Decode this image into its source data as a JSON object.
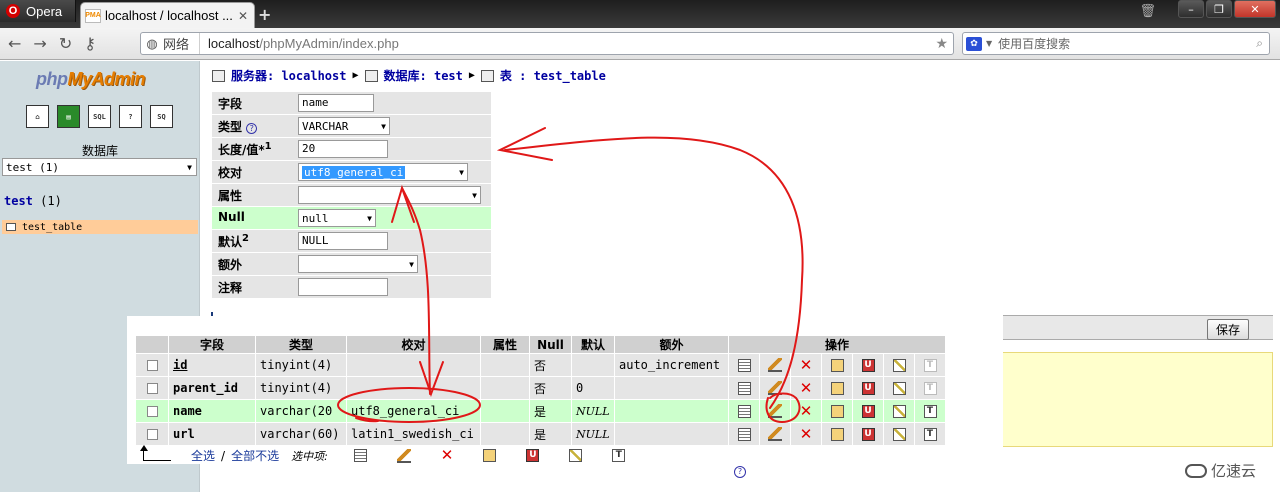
{
  "browser": {
    "opera_label": "Opera",
    "tab_title": "localhost / localhost ...",
    "tab_favicon": "PMA",
    "tab_close": "✕",
    "new_tab": "+",
    "url_net_label": "网络",
    "url_host": "localhost",
    "url_path": "/phpMyAdmin/index.php",
    "search_placeholder": "使用百度搜索"
  },
  "left": {
    "logo_php": "php",
    "logo_myadmin": "MyAdmin",
    "icons": [
      "home-icon",
      "query-window-icon",
      "sql-icon",
      "help-icon",
      "sql-doc-icon"
    ],
    "db_label": "数据库",
    "db_select_value": "test (1)",
    "db_title": "test",
    "db_count": "(1)",
    "table_item": "test_table"
  },
  "breadcrumb": {
    "server": "服务器: localhost",
    "database": "数据库: test",
    "table": "表 : test_table"
  },
  "form": {
    "field_label": "字段",
    "field_value": "name",
    "type_label": "类型",
    "type_value": "VARCHAR",
    "length_label": "长度/值*",
    "length_sup": "1",
    "length_value": "20",
    "collation_label": "校对",
    "collation_value": "utf8_general_ci",
    "attributes_label": "属性",
    "attributes_value": "",
    "null_label": "Null",
    "null_value": "null",
    "default_label": "默认",
    "default_sup": "2",
    "default_value": "NULL",
    "extra_label": "额外",
    "extra_value": "",
    "comment_label": "注释",
    "comment_value": ""
  },
  "save_label": "保存",
  "structure": {
    "headers": [
      "字段",
      "类型",
      "校对",
      "属性",
      "Null",
      "默认",
      "额外",
      "操作"
    ],
    "rows": [
      {
        "field": "id",
        "type": "tinyint(4)",
        "collation": "",
        "attributes": "",
        "null": "否",
        "default": "",
        "extra": "auto_increment"
      },
      {
        "field": "parent_id",
        "type": "tinyint(4)",
        "collation": "",
        "attributes": "",
        "null": "否",
        "default": "0",
        "extra": ""
      },
      {
        "field": "name",
        "type": "varchar(20",
        "collation": "utf8_general_ci",
        "attributes": "",
        "null": "是",
        "default": "NULL",
        "extra": ""
      },
      {
        "field": "url",
        "type": "varchar(60)",
        "collation": "latin1_swedish_ci",
        "attributes": "",
        "null": "是",
        "default": "NULL",
        "extra": ""
      }
    ],
    "check_all": "全选",
    "uncheck_all": "全部不选",
    "with_selected": "选中项:",
    "slash": "/"
  },
  "watermark": "亿速云",
  "colors": {
    "annotation_red": "#e01818",
    "null_row_green": "#ccffcc",
    "selected_table": "#ffcc99"
  }
}
